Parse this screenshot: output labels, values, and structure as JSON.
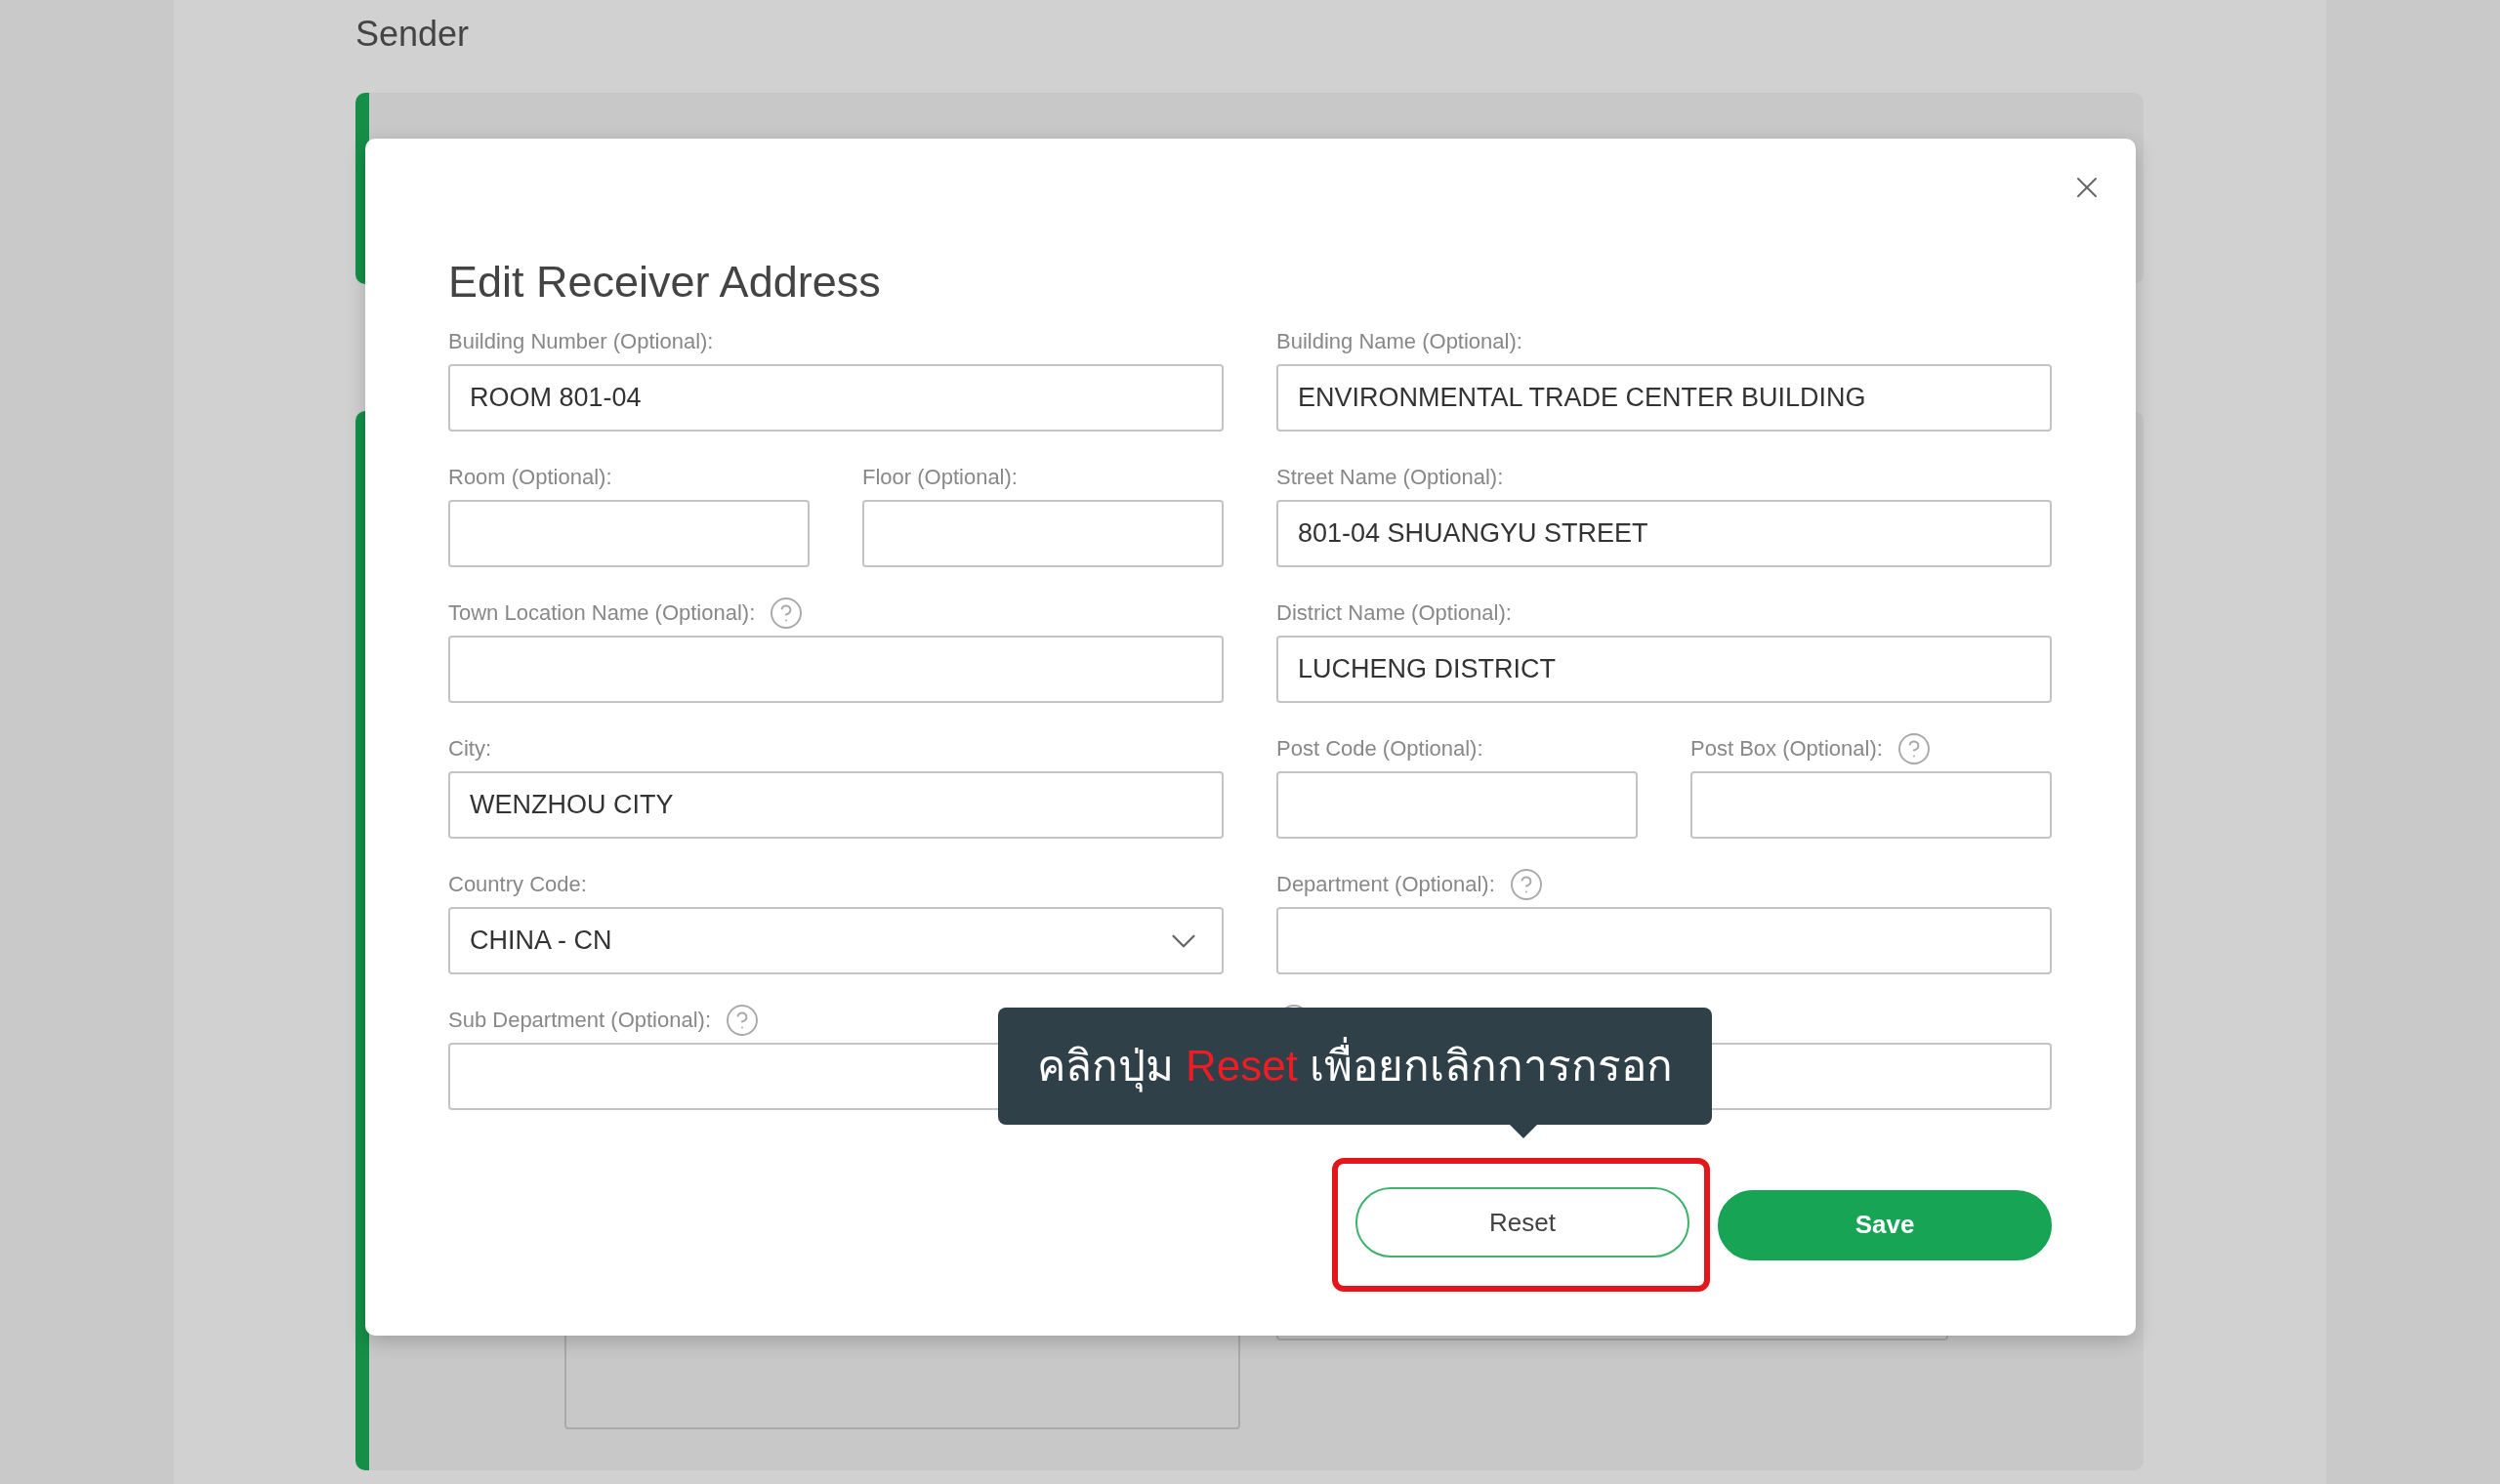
{
  "background": {
    "section_title": "Sender"
  },
  "dialog": {
    "title": "Edit Receiver Address",
    "rows": [
      {
        "left": [
          {
            "kind": "text",
            "label": "Building Number (Optional):",
            "value": "ROOM 801-04",
            "help": false
          }
        ],
        "right": [
          {
            "kind": "text",
            "label": "Building Name (Optional):",
            "value": "ENVIRONMENTAL TRADE CENTER BUILDING",
            "help": false
          }
        ]
      },
      {
        "left": [
          {
            "kind": "text",
            "label": "Room (Optional):",
            "help": false
          },
          {
            "kind": "text",
            "label": "Floor (Optional):",
            "help": false
          }
        ],
        "right": [
          {
            "kind": "text",
            "label": "Street Name (Optional):",
            "value": "801-04 SHUANGYU STREET",
            "help": false
          }
        ]
      },
      {
        "left": [
          {
            "kind": "text",
            "label": "Town Location Name (Optional):",
            "help": true
          }
        ],
        "right": [
          {
            "kind": "text",
            "label": "District Name (Optional):",
            "value": "LUCHENG DISTRICT",
            "help": false
          }
        ]
      },
      {
        "left": [
          {
            "kind": "text",
            "label": "City:",
            "value": "WENZHOU CITY",
            "help": false
          }
        ],
        "right": [
          {
            "kind": "text",
            "label": "Post Code (Optional):",
            "help": false
          },
          {
            "kind": "text",
            "label": "Post Box (Optional):",
            "help": true
          }
        ]
      },
      {
        "left": [
          {
            "kind": "select",
            "label": "Country Code:",
            "value": "CHINA - CN",
            "help": false
          }
        ],
        "right": [
          {
            "kind": "text",
            "label": "Department (Optional):",
            "help": true
          }
        ]
      },
      {
        "left": [
          {
            "kind": "text",
            "label": "Sub Department (Optional):",
            "help": true
          }
        ],
        "right": [
          {
            "kind": "text",
            "help": true
          }
        ]
      }
    ],
    "buttons": [
      {
        "kind": "outline",
        "label": "Reset",
        "highlighted": true
      },
      {
        "kind": "primary",
        "label": "Save",
        "highlighted": false
      }
    ]
  },
  "tooltip": {
    "text": "คลิกปุ่ม **Reset** เพื่อยกเลิกการกรอก"
  }
}
